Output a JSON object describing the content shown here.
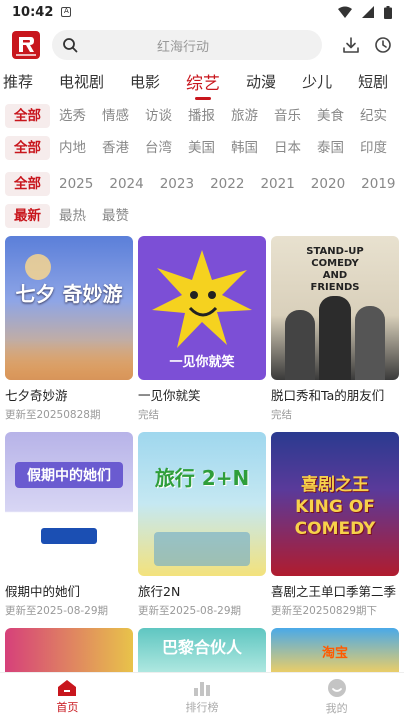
{
  "status_bar": {
    "time": "10:42",
    "notification_icon": "A"
  },
  "search": {
    "placeholder": "红海行动"
  },
  "channels": [
    "推荐",
    "电视剧",
    "电影",
    "综艺",
    "动漫",
    "少儿",
    "短剧"
  ],
  "active_channel_index": 3,
  "filters": {
    "type": {
      "items": [
        "全部",
        "选秀",
        "情感",
        "访谈",
        "播报",
        "旅游",
        "音乐",
        "美食",
        "纪实"
      ],
      "active": 0
    },
    "region": {
      "items": [
        "全部",
        "内地",
        "香港",
        "台湾",
        "美国",
        "韩国",
        "日本",
        "泰国",
        "印度"
      ],
      "active": 0
    },
    "year": {
      "items": [
        "全部",
        "2025",
        "2024",
        "2023",
        "2022",
        "2021",
        "2020",
        "2019"
      ],
      "active": 0
    },
    "sort": {
      "items": [
        "最新",
        "最热",
        "最赞"
      ],
      "active": 0
    }
  },
  "cards": [
    {
      "title": "七夕奇妙游",
      "subtitle": "更新至20250828期",
      "poster_text": "七夕 奇妙游",
      "color_top": "#5b7fd9",
      "color_bottom": "#f3b564"
    },
    {
      "title": "一见你就笑",
      "subtitle": "完结",
      "poster_text": "一见你就笑",
      "color_top": "#7c4fd6",
      "color_bottom": "#f5d21f"
    },
    {
      "title": "脱口秀和Ta的朋友们",
      "subtitle": "完结",
      "poster_text": "STAND-UP COMEDY AND FRIENDS",
      "color_top": "#e8e1cf",
      "color_bottom": "#3a3a3a"
    },
    {
      "title": "假期中的她们",
      "subtitle": "更新至2025-08-29期",
      "poster_text": "假期中的她们",
      "color_top": "#b7b3e8",
      "color_bottom": "#ffffff"
    },
    {
      "title": "旅行2N",
      "subtitle": "更新至2025-08-29期",
      "poster_text": "旅行 2+N",
      "color_top": "#9fd7ee",
      "color_bottom": "#f3e27c"
    },
    {
      "title": "喜剧之王单口季第二季",
      "subtitle": "更新至20250829期下",
      "poster_text": "喜剧之王 KING OF COMEDY",
      "color_top": "#2a3a8f",
      "color_bottom": "#b01c2e"
    },
    {
      "title": "",
      "subtitle": "",
      "poster_text": "",
      "color_top": "#d6407a",
      "color_bottom": "#e8c34a"
    },
    {
      "title": "",
      "subtitle": "",
      "poster_text": "巴黎合伙人",
      "color_top": "#5fc6c1",
      "color_bottom": "#b9ece4"
    },
    {
      "title": "",
      "subtitle": "",
      "poster_text": "淘宝",
      "color_top": "#4aa9e8",
      "color_bottom": "#ffd257"
    }
  ],
  "bottom_nav": [
    {
      "label": "首页",
      "icon": "home-icon"
    },
    {
      "label": "排行榜",
      "icon": "ranking-icon"
    },
    {
      "label": "我的",
      "icon": "profile-icon"
    }
  ],
  "bottom_nav_active": 0,
  "colors": {
    "accent": "#c8161d",
    "muted": "#888888"
  }
}
